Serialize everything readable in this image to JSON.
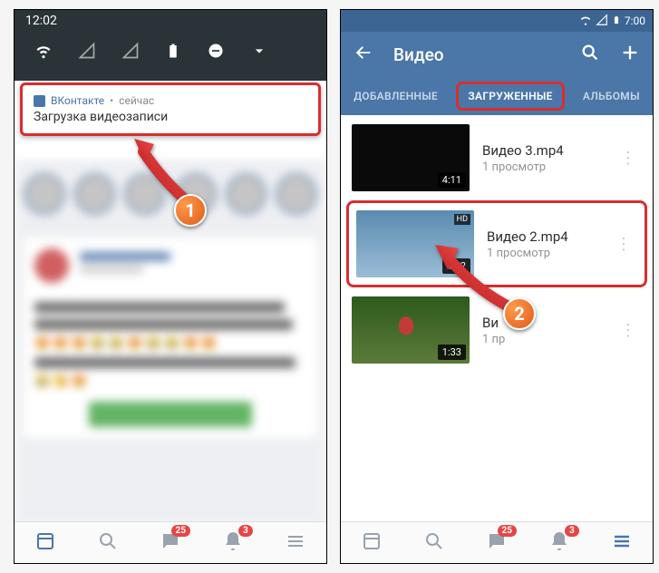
{
  "left": {
    "statusTime": "12:02",
    "notif": {
      "source": "ВКонтакте",
      "separator": "•",
      "when": "сейчас",
      "message": "Загрузка видеозаписи"
    },
    "nav": {
      "messagesBadge": "25",
      "notifBadge": "3"
    }
  },
  "right": {
    "statusTime": "7:00",
    "appbar": {
      "title": "Видео"
    },
    "tabs": {
      "added": "ДОБАВЛЕННЫЕ",
      "uploaded": "ЗАГРУЖЕННЫЕ",
      "albums": "АЛЬБОМЫ"
    },
    "videos": [
      {
        "title": "Видео 3.mp4",
        "author": "",
        "views": "1 просмотр",
        "duration": "4:11"
      },
      {
        "title": "Видео 2.mp4",
        "author": "",
        "views": "1 просмотр",
        "duration": "1:52",
        "hd": "HD"
      },
      {
        "title": "Ви",
        "author": "",
        "views": "1 пр",
        "duration": "1:33"
      }
    ],
    "nav": {
      "messagesBadge": "25",
      "notifBadge": "3"
    }
  },
  "annotations": {
    "step1": "1",
    "step2": "2"
  }
}
